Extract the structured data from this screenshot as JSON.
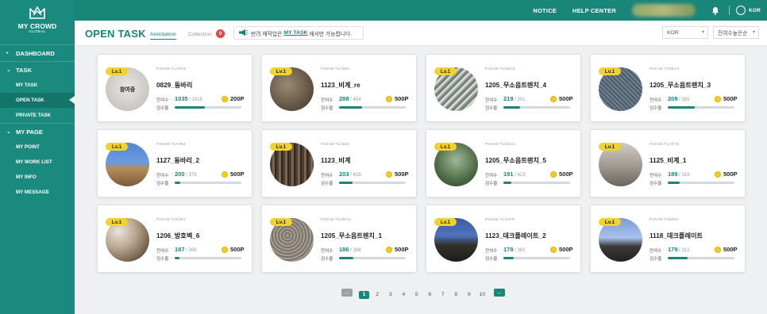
{
  "topbar": {
    "notice": "NOTICE",
    "help_center": "HELP CENTER",
    "lang": "KOR",
    "bell_icon": "bell-icon",
    "globe_icon": "globe-icon"
  },
  "brand": {
    "name": "MY CROWD",
    "sub": "GLOBAL"
  },
  "sidebar": {
    "dashboard": "DASHBOARD",
    "task": "TASK",
    "task_items": [
      "MY TASK",
      "OPEN TASK",
      "PRIVATE TASK"
    ],
    "mypage": "MY PAGE",
    "mypage_items": [
      "MY POINT",
      "MY WORK LIST",
      "MY INFO",
      "MY MESSAGE"
    ],
    "active": "OPEN TASK"
  },
  "header": {
    "title": "OPEN TASK",
    "tab_annotation": "Annotation",
    "tab_collection": "Collection",
    "collection_count": "0",
    "notice_before": "반려 재작업은",
    "notice_link": "MY TASK",
    "notice_after": "에서만 가능합니다.",
    "language_select": "KOR",
    "sort_select": "잔여수높은순"
  },
  "labels": {
    "remaining": "잔여수",
    "inspection": "검수율"
  },
  "colors": {
    "brand": "#19867a",
    "accent_yellow": "#f2d22c",
    "badge_red": "#e64545"
  },
  "cards": [
    {
      "level": "Lv.1",
      "code": "P2SAB-T1A4CE",
      "name": "0829_동바리",
      "remaining": "1035",
      "total": "2315",
      "points": "200P",
      "progress": 0.45,
      "img": "text",
      "img_text": "참여중"
    },
    {
      "level": "Lv.1",
      "code": "P2SAB-T1A804",
      "name": "1123_비계_re",
      "remaining": "288",
      "total": "454",
      "points": "500P",
      "progress": 0.35,
      "img": "pile"
    },
    {
      "level": "Lv.1",
      "code": "P2SAB-T1DEC5",
      "name": "1205_무소음트렌치_4",
      "remaining": "219",
      "total": "301",
      "points": "500P",
      "progress": 0.25,
      "img": "bundle"
    },
    {
      "level": "Lv.1",
      "code": "P2SAB-T1DEC4",
      "name": "1205_무소음트렌치_3",
      "remaining": "209",
      "total": "381",
      "points": "500P",
      "progress": 0.4,
      "img": "mesh"
    },
    {
      "level": "Lv.1",
      "code": "P2SAB-T1A7B4",
      "name": "1127_동바리_2",
      "remaining": "200",
      "total": "375",
      "points": "500P",
      "progress": 0.08,
      "img": "sky"
    },
    {
      "level": "Lv.1",
      "code": "P2SAB-T1A802",
      "name": "1123_비계",
      "remaining": "203",
      "total": "428",
      "points": "500P",
      "progress": 0.2,
      "img": "timber"
    },
    {
      "level": "Lv.1",
      "code": "P2SAB-T1DEC6",
      "name": "1205_무소음트렌치_5",
      "remaining": "191",
      "total": "423",
      "points": "500P",
      "progress": 0.12,
      "img": "green"
    },
    {
      "level": "Lv.1",
      "code": "P2SAB-T1AF7D",
      "name": "1125_비계_1",
      "remaining": "189",
      "total": "316",
      "points": "500P",
      "progress": 0.18,
      "img": "grey"
    },
    {
      "level": "Lv.1",
      "code": "P2SAB-T1E3E1",
      "name": "1206_방호벽_6",
      "remaining": "187",
      "total": "399",
      "points": "500P",
      "progress": 0.07,
      "img": "barrier"
    },
    {
      "level": "Lv.1",
      "code": "P2SAB-T1DEC2",
      "name": "1205_무소음트렌치_1",
      "remaining": "186",
      "total": "388",
      "points": "500P",
      "progress": 0.22,
      "img": "rubble"
    },
    {
      "level": "Lv.1",
      "code": "P2SAB-T1AAFE",
      "name": "1123_데크플레이트_2",
      "remaining": "178",
      "total": "382",
      "points": "500P",
      "progress": 0.15,
      "img": "deck"
    },
    {
      "level": "Lv.1",
      "code": "P2SAB-T1B69A",
      "name": "1118_데크플레이트",
      "remaining": "179",
      "total": "312",
      "points": "500P",
      "progress": 0.3,
      "img": "deck2"
    }
  ],
  "pagination": {
    "pages": [
      "1",
      "2",
      "3",
      "4",
      "5",
      "6",
      "7",
      "8",
      "9",
      "10"
    ],
    "current": "1"
  }
}
